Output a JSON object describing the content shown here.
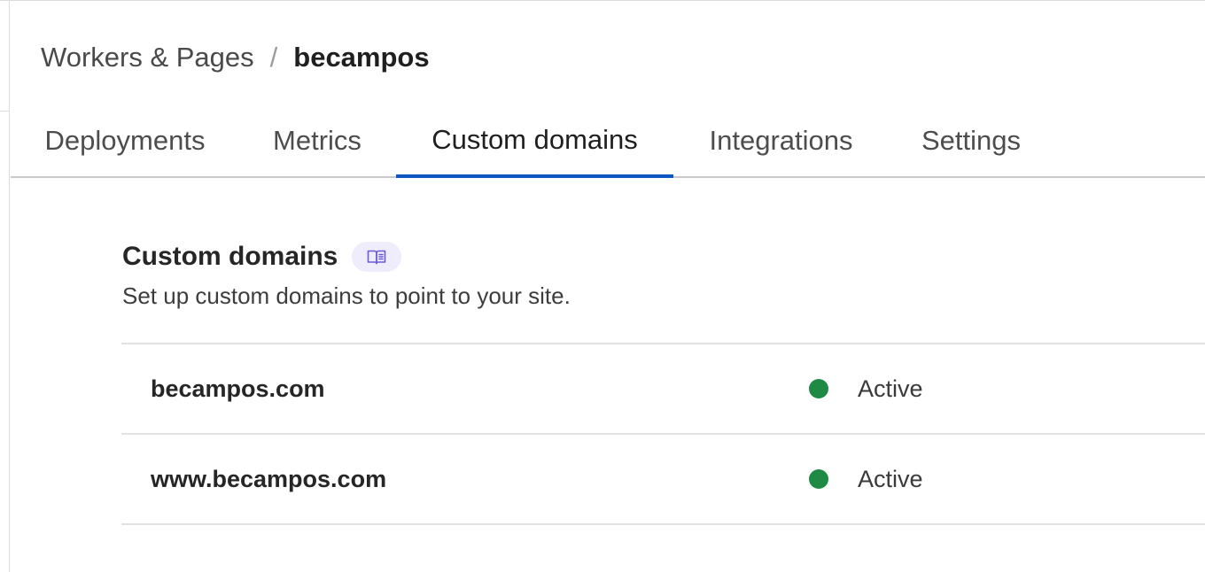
{
  "breadcrumb": {
    "parent": "Workers & Pages",
    "separator": "/",
    "current": "becampos"
  },
  "tabs": [
    {
      "label": "Deployments",
      "active": false
    },
    {
      "label": "Metrics",
      "active": false
    },
    {
      "label": "Custom domains",
      "active": true
    },
    {
      "label": "Integrations",
      "active": false
    },
    {
      "label": "Settings",
      "active": false
    }
  ],
  "section": {
    "title": "Custom domains",
    "docs_icon": "book-icon",
    "description": "Set up custom domains to point to your site."
  },
  "domains": [
    {
      "name": "becampos.com",
      "status": "Active",
      "status_color": "#1e8a44"
    },
    {
      "name": "www.becampos.com",
      "status": "Active",
      "status_color": "#1e8a44"
    }
  ],
  "colors": {
    "accent": "#0b55c4",
    "badge_bg": "#efecfb",
    "badge_icon": "#6b5bd6",
    "status_active": "#1e8a44"
  }
}
